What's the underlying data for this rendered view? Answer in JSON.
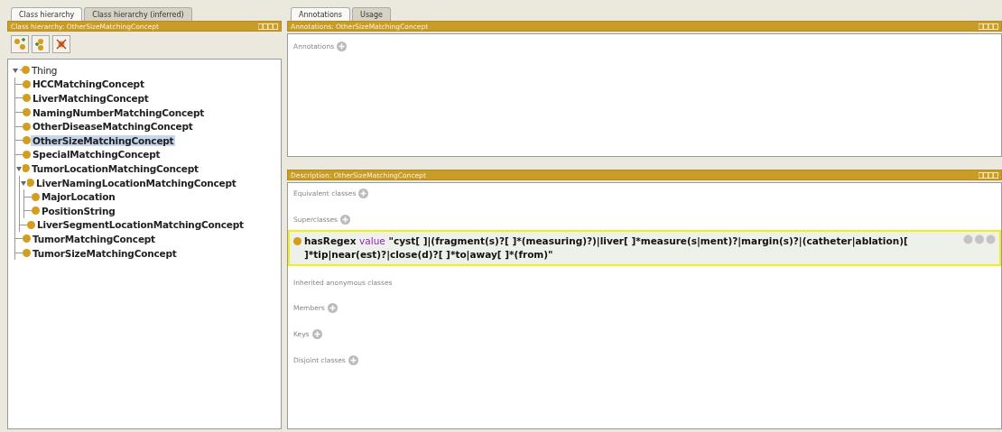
{
  "left": {
    "tabs": [
      {
        "label": "Class hierarchy",
        "selected": true
      },
      {
        "label": "Class hierarchy (inferred)",
        "selected": false
      }
    ],
    "header": "Class hierarchy: OtherSizeMatchingConcept",
    "tree": [
      {
        "label": "Thing",
        "selected": false,
        "expanded": true,
        "children": [
          {
            "label": "HCCMatchingConcept",
            "selected": false
          },
          {
            "label": "LiverMatchingConcept",
            "selected": false
          },
          {
            "label": "NamingNumberMatchingConcept",
            "selected": false
          },
          {
            "label": "OtherDiseaseMatchingConcept",
            "selected": false
          },
          {
            "label": "OtherSizeMatchingConcept",
            "selected": true
          },
          {
            "label": "SpecialMatchingConcept",
            "selected": false
          },
          {
            "label": "TumorLocationMatchingConcept",
            "selected": false,
            "expanded": true,
            "children": [
              {
                "label": "LiverNamingLocationMatchingConcept",
                "selected": false,
                "expanded": true,
                "children": [
                  {
                    "label": "MajorLocation",
                    "selected": false
                  },
                  {
                    "label": "PositionString",
                    "selected": false
                  }
                ]
              },
              {
                "label": "LiverSegmentLocationMatchingConcept",
                "selected": false
              }
            ]
          },
          {
            "label": "TumorMatchingConcept",
            "selected": false
          },
          {
            "label": "TumorSizeMatchingConcept",
            "selected": false
          }
        ]
      }
    ]
  },
  "right": {
    "tabs": [
      {
        "label": "Annotations",
        "selected": true
      },
      {
        "label": "Usage",
        "selected": false
      }
    ],
    "annotations_header": "Annotations: OtherSizeMatchingConcept",
    "annotations_label": "Annotations",
    "description_header": "Description: OtherSizeMatchingConcept",
    "sections": [
      {
        "label": "Equivalent classes",
        "addable": true
      },
      {
        "label": "Superclasses",
        "addable": true,
        "axioms": [
          {
            "property": "hasRegex",
            "keyword": "value",
            "literal": "\"cyst[ ]|(fragment(s)?[ ]*(measuring)?)|liver[ ]*measure(s|ment)?|margin(s)?|(catheter|ablation)[ ]*tip|near(est)?|close(d)?[ ]*to|away[ ]*(from)\"",
            "selected": true
          }
        ]
      },
      {
        "label": "Inherited anonymous classes",
        "addable": false
      },
      {
        "label": "Members",
        "addable": true
      },
      {
        "label": "Keys",
        "addable": true
      },
      {
        "label": "Disjoint classes",
        "addable": true
      }
    ]
  }
}
